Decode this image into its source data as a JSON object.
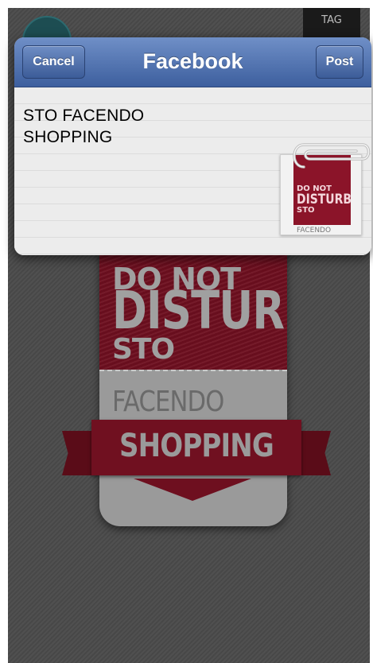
{
  "background": {
    "right_badge_text": "TAG",
    "tag": {
      "line1": "DO NOT",
      "line2": "DISTURB",
      "line3": "STO",
      "line4": "FACENDO",
      "ribbon": "SHOPPING"
    }
  },
  "sheet": {
    "title": "Facebook",
    "cancel_label": "Cancel",
    "post_label": "Post",
    "message": "STO FACENDO\nSHOPPING",
    "attachment": {
      "line1": "DO NOT",
      "line2": "DISTURB",
      "line3": "STO",
      "line4": "FACENDO"
    }
  },
  "colors": {
    "header_blue": "#3d5f9e",
    "tag_red": "#6e0f1f"
  }
}
